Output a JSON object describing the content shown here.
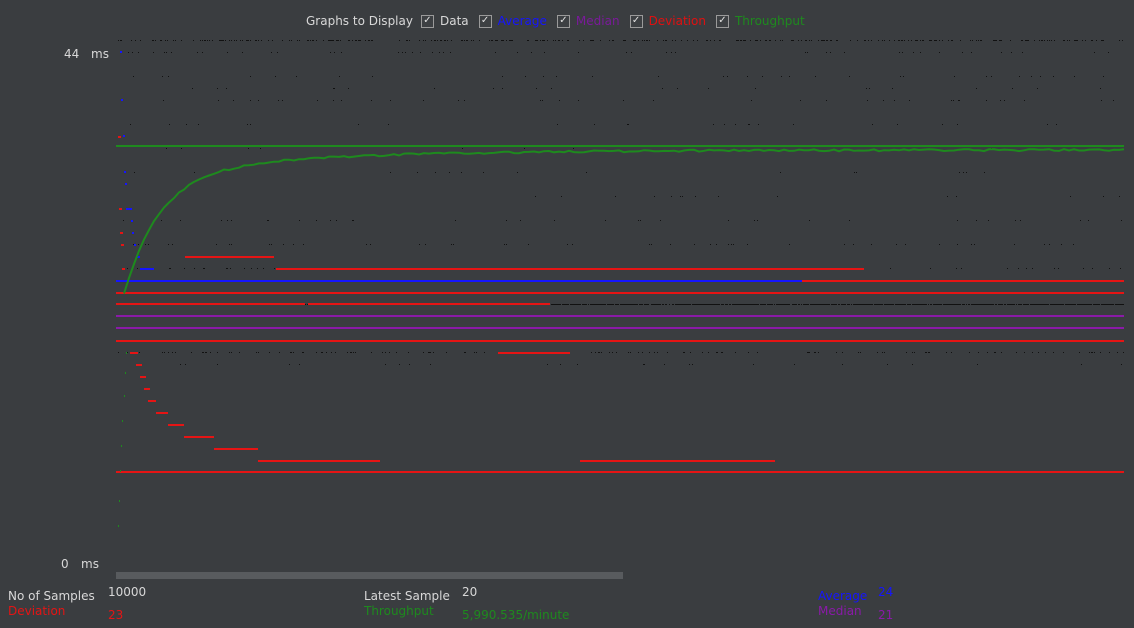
{
  "header": {
    "title": "Graphs to Display",
    "toggles": [
      {
        "label": "Data",
        "checked": true,
        "color": "#d8d8d8"
      },
      {
        "label": "Average",
        "checked": true,
        "color": "#1515ff"
      },
      {
        "label": "Median",
        "checked": true,
        "color": "#7a1a9a"
      },
      {
        "label": "Deviation",
        "checked": true,
        "color": "#e01010"
      },
      {
        "label": "Throughput",
        "checked": true,
        "color": "#1e8a1e"
      }
    ]
  },
  "axis": {
    "y_max": "44",
    "y_min": "0",
    "unit": "ms"
  },
  "stats": {
    "samples_label": "No of Samples",
    "samples_value": "10000",
    "deviation_label": "Deviation",
    "deviation_value": "23",
    "latest_label": "Latest Sample",
    "latest_value": "20",
    "throughput_label": "Throughput",
    "throughput_value": "5,990.535/minute",
    "average_label": "Average",
    "average_value": "24",
    "median_label": "Median",
    "median_value": "21"
  },
  "colors": {
    "data": "#111111",
    "average": "#1515ff",
    "median": "#8a1aa8",
    "deviation": "#e51414",
    "throughput": "#1e8a1e"
  },
  "chart_data": {
    "type": "line",
    "title": "",
    "ylabel": "ms",
    "ylim": [
      0,
      44
    ],
    "x_samples": 10000,
    "series": [
      {
        "name": "Average",
        "final_value": 24
      },
      {
        "name": "Median",
        "final_value": 21
      },
      {
        "name": "Deviation",
        "final_value": 23
      },
      {
        "name": "Throughput",
        "final_value": "5,990.535/minute"
      }
    ]
  }
}
